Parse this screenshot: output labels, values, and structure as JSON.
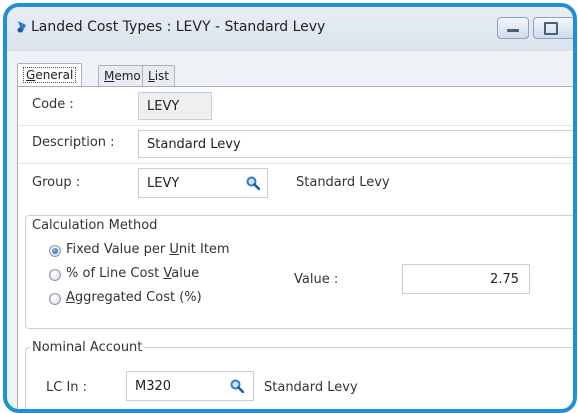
{
  "window": {
    "title": "Landed Cost Types : LEVY - Standard Levy"
  },
  "tabs": [
    {
      "label_pre": "",
      "label_key": "G",
      "label_post": "eneral",
      "active": true
    },
    {
      "label_pre": "",
      "label_key": "M",
      "label_post": "emo",
      "active": false
    },
    {
      "label_pre": "",
      "label_key": "L",
      "label_post": "ist",
      "active": false
    }
  ],
  "form": {
    "code_label": "Code :",
    "code_value": "LEVY",
    "description_label": "Description :",
    "description_value": "Standard Levy",
    "group_label": "Group :",
    "group_value": "LEVY",
    "group_name": "Standard Levy"
  },
  "calculation": {
    "title": "Calculation Method",
    "options": [
      {
        "pre": "Fixed Value per ",
        "key": "U",
        "post": "nit Item",
        "checked": true
      },
      {
        "pre": "% of Line Cost ",
        "key": "V",
        "post": "alue",
        "checked": false
      },
      {
        "pre": "",
        "key": "A",
        "post": "ggregated Cost (%)",
        "checked": false
      }
    ],
    "value_label": "Value :",
    "value": "2.75"
  },
  "nominal": {
    "title": "Nominal Account",
    "lc_in_label": "LC In :",
    "lc_in_value": "M320",
    "lc_in_name": "Standard Levy"
  },
  "icons": {
    "app": "app-icon",
    "lookup": "magnifier-icon"
  },
  "colors": {
    "frame_border": "#1f8fd6",
    "lookup_icon": "#2a7fd0",
    "radio_checked": "#1d5ea8"
  }
}
